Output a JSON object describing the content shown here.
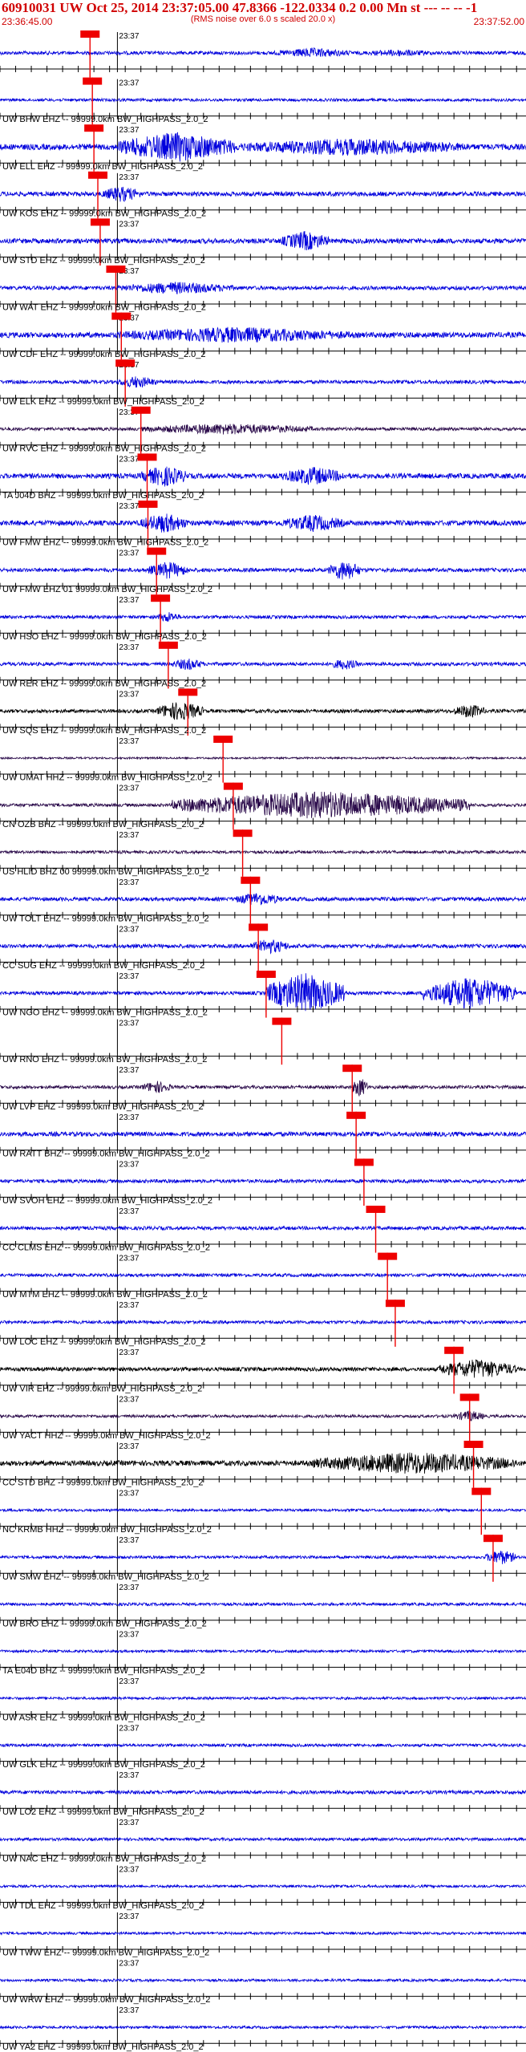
{
  "title": "60910031 UW Oct 25, 2014 23:37:05.00   47.8366 -122.0334  0.2 0.00 Mn st --- -- --  -1",
  "subtitle": "(RMS noise over 6.0 s scaled 20.0 x)",
  "time_start": "23:36:45.00",
  "time_end": "23:37:52.00",
  "minute_label": "23:37",
  "colors": {
    "header_text": "#d00000",
    "trace_blue": "#0000dd",
    "trace_black": "#000000",
    "trace_purple": "#2a0a4a",
    "pick": "#ee0000",
    "axis": "#000000"
  },
  "chart_data": {
    "type": "seismogram",
    "time_range_s": [
      0,
      67
    ],
    "tick_interval_s": 2,
    "traces": [
      {
        "label": "",
        "pick_s": 11.5,
        "amp": 0.55,
        "color": "blue",
        "bursts": [
          [
            35,
            45,
            0.8
          ],
          [
            46,
            56,
            0.6
          ]
        ]
      },
      {
        "label": "UW BHW EHZ -- 99999.0km BW_HIGHPASS_2.0_2",
        "pick_s": 11.8,
        "amp": 0.45,
        "color": "blue",
        "bursts": []
      },
      {
        "label": "UW ELL EHZ -- 99999.0km BW_HIGHPASS_2.0_2",
        "pick_s": 12.0,
        "amp": 0.9,
        "color": "blue",
        "bursts": [
          [
            15,
            30,
            2.4
          ],
          [
            30,
            60,
            1.4
          ]
        ]
      },
      {
        "label": "UW KOS EHZ -- 99999.0km BW_HIGHPASS_2.0_2",
        "pick_s": 12.5,
        "amp": 0.7,
        "color": "blue",
        "bursts": [
          [
            13,
            18,
            1.3
          ]
        ]
      },
      {
        "label": "UW STD EHZ -- 99999.0km BW_HIGHPASS_2.0_2",
        "pick_s": 12.8,
        "amp": 0.75,
        "color": "blue",
        "bursts": [
          [
            36,
            42,
            1.6
          ]
        ]
      },
      {
        "label": "UW WAT EHZ -- 99999.0km BW_HIGHPASS_2.0_2",
        "pick_s": 14.8,
        "amp": 0.6,
        "color": "blue",
        "bursts": [
          [
            15,
            30,
            1.0
          ]
        ]
      },
      {
        "label": "UW CDF EHZ -- 99999.0km BW_HIGHPASS_2.0_2",
        "pick_s": 15.5,
        "amp": 0.85,
        "color": "blue",
        "bursts": [
          [
            15,
            45,
            1.3
          ]
        ]
      },
      {
        "label": "UW ELK EHZ -- 99999.0km BW_HIGHPASS_2.0_2",
        "pick_s": 16.0,
        "amp": 0.55,
        "color": "blue",
        "bursts": [
          [
            15,
            20,
            1.0
          ]
        ]
      },
      {
        "label": "UW RVC EHZ -- 99999.0km BW_HIGHPASS_2.0_2",
        "pick_s": 18.0,
        "amp": 0.5,
        "color": "purple",
        "bursts": [
          [
            18,
            40,
            0.9
          ]
        ]
      },
      {
        "label": "TA J04D BHZ -- 99999.0km BW_HIGHPASS_2.0_2",
        "pick_s": 18.8,
        "amp": 0.8,
        "color": "blue",
        "bursts": [
          [
            18,
            24,
            1.7
          ],
          [
            36,
            44,
            1.5
          ]
        ]
      },
      {
        "label": "UW FMW EHZ -- 99999.0km BW_HIGHPASS_2.0_2",
        "pick_s": 18.9,
        "amp": 0.8,
        "color": "blue",
        "bursts": [
          [
            18,
            24,
            1.6
          ],
          [
            36,
            44,
            1.4
          ]
        ]
      },
      {
        "label": "UW FMW EHZ 01 99999.0km BW_HIGHPASS_2.0_2",
        "pick_s": 20.0,
        "amp": 0.6,
        "color": "blue",
        "bursts": [
          [
            19,
            24,
            1.4
          ],
          [
            42,
            46,
            1.7
          ]
        ]
      },
      {
        "label": "UW HSO EHZ -- 99999.0km BW_HIGHPASS_2.0_2",
        "pick_s": 20.5,
        "amp": 0.5,
        "color": "blue",
        "bursts": [
          [
            20,
            23,
            0.9
          ]
        ]
      },
      {
        "label": "UW RER EHZ -- 99999.0km BW_HIGHPASS_2.0_2",
        "pick_s": 21.5,
        "amp": 0.55,
        "color": "blue",
        "bursts": [
          [
            22,
            26,
            1.0
          ],
          [
            42,
            46,
            0.9
          ]
        ]
      },
      {
        "label": "UW SQS EHZ -- 99999.0km BW_HIGHPASS_2.0_2",
        "pick_s": 24.0,
        "amp": 0.55,
        "color": "black",
        "bursts": [
          [
            20,
            26,
            1.6
          ],
          [
            58,
            62,
            1.2
          ]
        ]
      },
      {
        "label": "UW UMAT HHZ -- 99999.0km BW_HIGHPASS_2.0_2",
        "pick_s": 28.5,
        "amp": 0.3,
        "color": "purple",
        "bursts": []
      },
      {
        "label": "CN OZB BHZ -- 99999.0km BW_HIGHPASS_2.0_2",
        "pick_s": 29.8,
        "amp": 0.5,
        "color": "purple",
        "bursts": [
          [
            22,
            60,
            2.2
          ]
        ]
      },
      {
        "label": "US HLID BHZ 00 99999.0km BW_HIGHPASS_2.0_2",
        "pick_s": 31.0,
        "amp": 0.45,
        "color": "purple",
        "bursts": []
      },
      {
        "label": "UW TOLT EHZ -- 99999.0km BW_HIGHPASS_2.0_2",
        "pick_s": 32.0,
        "amp": 0.6,
        "color": "blue",
        "bursts": [
          [
            30,
            36,
            1.1
          ]
        ]
      },
      {
        "label": "CC SUG EHZ -- 99999.0km BW_HIGHPASS_2.0_2",
        "pick_s": 33.0,
        "amp": 0.6,
        "color": "blue",
        "bursts": [
          [
            32,
            37,
            1.2
          ]
        ]
      },
      {
        "label": "UW NGO EHZ -- 99999.0km BW_HIGHPASS_2.0_2",
        "pick_s": 34.0,
        "amp": 0.55,
        "color": "blue",
        "bursts": [
          [
            34,
            44,
            3.2
          ],
          [
            54,
            66,
            2.6
          ]
        ]
      },
      {
        "label": "UW RNO EHZ -- 99999.0km BW_HIGHPASS_2.0_2",
        "pick_s": 36.0,
        "amp": 0.0,
        "color": "blue",
        "bursts": []
      },
      {
        "label": "UW LVP EHZ -- 99999.0km BW_HIGHPASS_2.0_2",
        "pick_s": 45.0,
        "amp": 0.5,
        "color": "purple",
        "bursts": [
          [
            18,
            22,
            1.0
          ],
          [
            45,
            47,
            1.6
          ]
        ]
      },
      {
        "label": "UW RATT BHZ -- 99999.0km BW_HIGHPASS_2.0_2",
        "pick_s": 45.5,
        "amp": 0.7,
        "color": "blue",
        "bursts": []
      },
      {
        "label": "UW SVOH EHZ -- 99999.0km BW_HIGHPASS_2.0_2",
        "pick_s": 46.5,
        "amp": 0.55,
        "color": "blue",
        "bursts": []
      },
      {
        "label": "CC CLMS EHZ -- 99999.0km BW_HIGHPASS_2.0_2",
        "pick_s": 48.0,
        "amp": 0.55,
        "color": "blue",
        "bursts": []
      },
      {
        "label": "UW MTM EHZ -- 99999.0km BW_HIGHPASS_2.0_2",
        "pick_s": 49.5,
        "amp": 0.5,
        "color": "blue",
        "bursts": []
      },
      {
        "label": "UW LOC EHZ -- 99999.0km BW_HIGHPASS_2.0_2",
        "pick_s": 50.5,
        "amp": 0.5,
        "color": "blue",
        "bursts": []
      },
      {
        "label": "UW VIR EHZ -- 99999.0km BW_HIGHPASS_2.0_2",
        "pick_s": 58.0,
        "amp": 0.6,
        "color": "black",
        "bursts": [
          [
            56,
            66,
            1.6
          ]
        ]
      },
      {
        "label": "UW YACT HHZ -- 99999.0km BW_HIGHPASS_2.0_2",
        "pick_s": 60.0,
        "amp": 0.45,
        "color": "purple",
        "bursts": [
          [
            58,
            62,
            0.9
          ]
        ]
      },
      {
        "label": "CC STD BHZ -- 99999.0km BW_HIGHPASS_2.0_2",
        "pick_s": 60.5,
        "amp": 0.8,
        "color": "black",
        "bursts": [
          [
            40,
            66,
            1.8
          ]
        ]
      },
      {
        "label": "NC KRMB HHZ -- 99999.0km BW_HIGHPASS_2.0_2",
        "pick_s": 61.5,
        "amp": 0.4,
        "color": "blue",
        "bursts": []
      },
      {
        "label": "UW SMW EHZ -- 99999.0km BW_HIGHPASS_2.0_2",
        "pick_s": 63.0,
        "amp": 0.45,
        "color": "blue",
        "bursts": [
          [
            62,
            66,
            1.2
          ]
        ]
      },
      {
        "label": "UW BRO EHZ -- 99999.0km BW_HIGHPASS_2.0_2",
        "pick_s": null,
        "amp": 0.45,
        "color": "blue",
        "bursts": []
      },
      {
        "label": "TA E04D BHZ -- 99999.0km BW_HIGHPASS_2.0_2",
        "pick_s": null,
        "amp": 0.4,
        "color": "blue",
        "bursts": []
      },
      {
        "label": "UW ASR EHZ -- 99999.0km BW_HIGHPASS_2.0_2",
        "pick_s": null,
        "amp": 0.4,
        "color": "blue",
        "bursts": []
      },
      {
        "label": "UW GLK EHZ -- 99999.0km BW_HIGHPASS_2.0_2",
        "pick_s": null,
        "amp": 0.45,
        "color": "blue",
        "bursts": []
      },
      {
        "label": "UW LO2 EHZ -- 99999.0km BW_HIGHPASS_2.0_2",
        "pick_s": null,
        "amp": 0.55,
        "color": "blue",
        "bursts": []
      },
      {
        "label": "UW NAC EHZ -- 99999.0km BW_HIGHPASS_2.0_2",
        "pick_s": null,
        "amp": 0.45,
        "color": "blue",
        "bursts": []
      },
      {
        "label": "UW TDL EHZ -- 99999.0km BW_HIGHPASS_2.0_2",
        "pick_s": null,
        "amp": 0.4,
        "color": "blue",
        "bursts": []
      },
      {
        "label": "UW TWW EHZ -- 99999.0km BW_HIGHPASS_2.0_2",
        "pick_s": null,
        "amp": 0.4,
        "color": "blue",
        "bursts": []
      },
      {
        "label": "UW WRW EHZ -- 99999.0km BW_HIGHPASS_2.0_2",
        "pick_s": null,
        "amp": 0.4,
        "color": "blue",
        "bursts": []
      },
      {
        "label": "UW YA2 EHZ -- 99999.0km BW_HIGHPASS_2.0_2",
        "pick_s": null,
        "amp": 0.4,
        "color": "blue",
        "bursts": []
      }
    ]
  }
}
